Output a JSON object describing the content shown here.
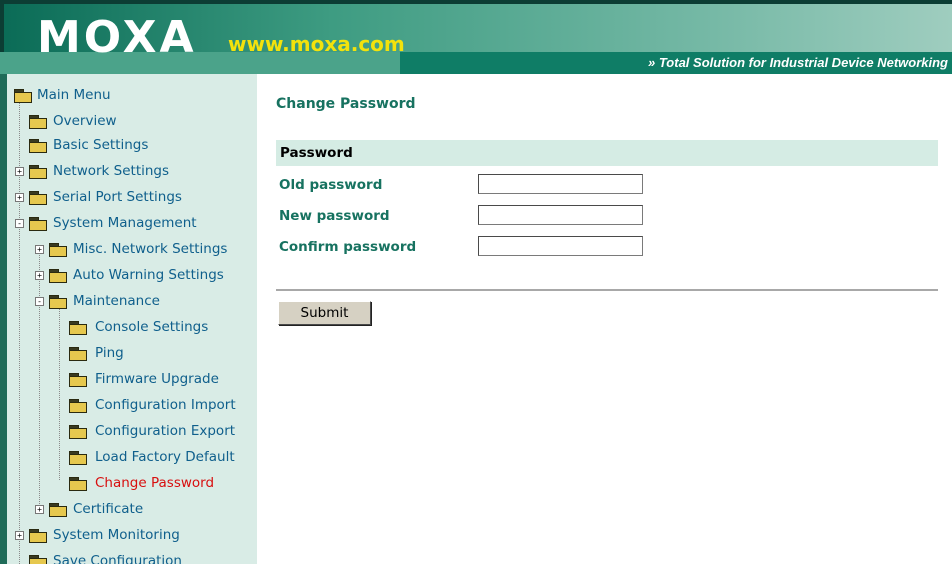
{
  "header": {
    "logo": "MOXA",
    "url": "www.moxa.com",
    "tagline": "» Total Solution for Industrial Device Networking"
  },
  "sidebar": {
    "items": [
      {
        "label": "Main Menu",
        "expander": "",
        "icon": "open-folder-icon"
      },
      {
        "label": "Overview",
        "expander": "",
        "icon": "folder-icon"
      },
      {
        "label": "Basic Settings",
        "expander": "",
        "icon": "folder-icon"
      },
      {
        "label": "Network Settings",
        "expander": "+",
        "icon": "folder-icon"
      },
      {
        "label": "Serial Port Settings",
        "expander": "+",
        "icon": "folder-icon"
      },
      {
        "label": "System Management",
        "expander": "-",
        "icon": "open-folder-icon"
      },
      {
        "label": "Misc. Network Settings",
        "expander": "+",
        "icon": "folder-icon"
      },
      {
        "label": "Auto Warning Settings",
        "expander": "+",
        "icon": "folder-icon"
      },
      {
        "label": "Maintenance",
        "expander": "-",
        "icon": "open-folder-icon"
      },
      {
        "label": "Console Settings",
        "expander": "",
        "icon": "folder-icon"
      },
      {
        "label": "Ping",
        "expander": "",
        "icon": "folder-icon"
      },
      {
        "label": "Firmware Upgrade",
        "expander": "",
        "icon": "folder-icon"
      },
      {
        "label": "Configuration Import",
        "expander": "",
        "icon": "folder-icon"
      },
      {
        "label": "Configuration Export",
        "expander": "",
        "icon": "folder-icon"
      },
      {
        "label": "Load Factory Default",
        "expander": "",
        "icon": "folder-icon"
      },
      {
        "label": "Change Password",
        "expander": "",
        "icon": "folder-icon",
        "active": true
      },
      {
        "label": "Certificate",
        "expander": "+",
        "icon": "folder-icon"
      },
      {
        "label": "System Monitoring",
        "expander": "+",
        "icon": "folder-icon"
      },
      {
        "label": "Save Configuration",
        "expander": "",
        "icon": "folder-icon"
      }
    ]
  },
  "main": {
    "title": "Change Password",
    "section": "Password",
    "fields": [
      {
        "label": "Old password",
        "value": ""
      },
      {
        "label": "New password",
        "value": ""
      },
      {
        "label": "Confirm password",
        "value": ""
      }
    ],
    "submit_label": "Submit"
  },
  "colors": {
    "accent": "#177260",
    "sidebar_bg": "#d9ece6",
    "active_item": "#d80f0f",
    "link": "#0f5f8c"
  }
}
